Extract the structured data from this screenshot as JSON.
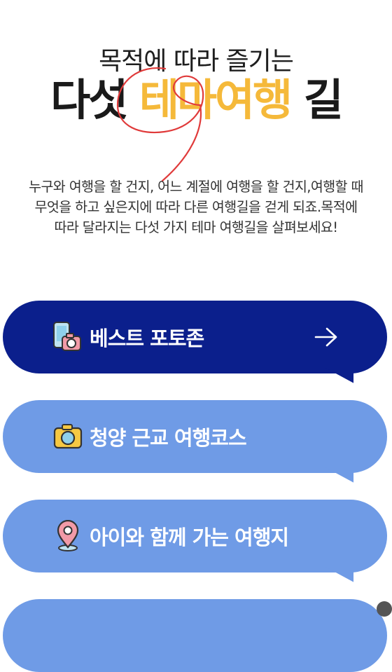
{
  "header": {
    "subtitle": "목적에 따라 즐기는",
    "title_pre": "다섯 ",
    "title_highlight": "테마여행",
    "title_post": " 길"
  },
  "description": {
    "line1": "누구와 여행을 할 건지, 어느 계절에 여행을 할 건지,여행할 때",
    "line2": "무엇을 하고 싶은지에 따라 다른 여행길을 걷게 되죠.목적에",
    "line3": "따라 달라지는 다섯 가지 테마 여행길을 살펴보세요!"
  },
  "menu": {
    "items": [
      {
        "label": "베스트 포토존",
        "icon": "phone-camera-icon"
      },
      {
        "label": "청양 근교 여행코스",
        "icon": "camera-icon"
      },
      {
        "label": "아이와 함께 가는 여행지",
        "icon": "map-pin-icon"
      }
    ],
    "arrow_icon": "arrow-right-icon"
  },
  "colors": {
    "highlight": "#f5b93a",
    "bubble_dark": "#0b1f8c",
    "bubble_light": "#6f9be6",
    "scribble": "#e03a3a"
  }
}
